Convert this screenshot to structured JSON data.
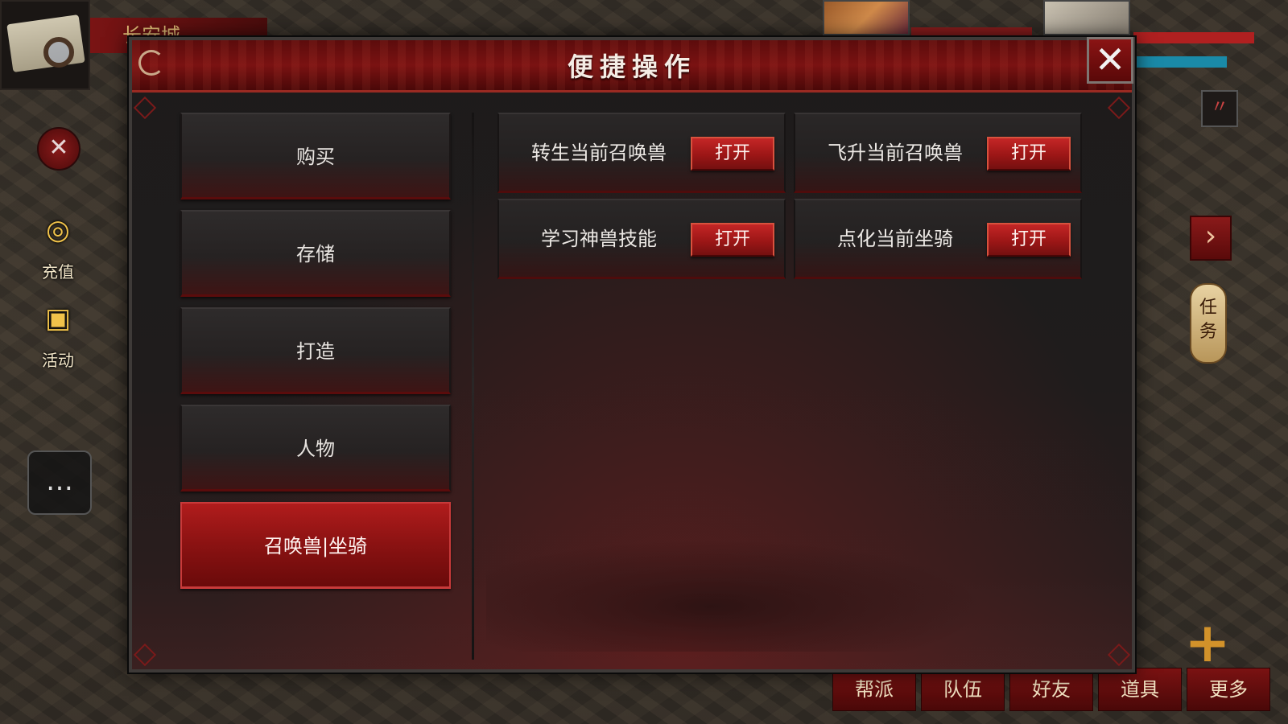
{
  "background": {
    "location_name": "长安城",
    "left_hud": [
      {
        "label": "充值",
        "icon": "coins-icon"
      },
      {
        "label": "活动",
        "icon": "gift-icon"
      }
    ],
    "quest_tab": "任务",
    "bottom_bar": [
      "帮派",
      "队伍",
      "好友",
      "道具",
      "更多"
    ]
  },
  "dialog": {
    "title": "便捷操作",
    "close_icon": "close-icon",
    "menu": [
      {
        "label": "购买",
        "active": false
      },
      {
        "label": "存储",
        "active": false
      },
      {
        "label": "打造",
        "active": false
      },
      {
        "label": "人物",
        "active": false
      },
      {
        "label": "召唤兽|坐骑",
        "active": true
      }
    ],
    "options": [
      {
        "label": "转生当前召唤兽",
        "button": "打开"
      },
      {
        "label": "飞升当前召唤兽",
        "button": "打开"
      },
      {
        "label": "学习神兽技能",
        "button": "打开"
      },
      {
        "label": "点化当前坐骑",
        "button": "打开"
      }
    ]
  },
  "colors": {
    "accent_red": "#9c1616",
    "active_menu": "#b01c1c",
    "panel_bg": "#1f1c1c",
    "title_text": "#f4ece4"
  }
}
